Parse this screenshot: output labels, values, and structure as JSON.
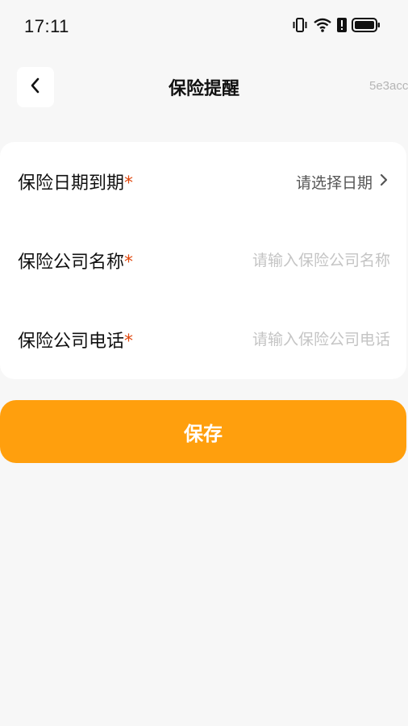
{
  "status_bar": {
    "time": "17:11",
    "icons": [
      "vibrate-icon",
      "wifi-icon",
      "alert-icon",
      "battery-icon"
    ]
  },
  "nav": {
    "back_icon": "chevron-left-icon",
    "title": "保险提醒",
    "id_text": "5e3acc"
  },
  "form": {
    "rows": [
      {
        "label": "保险日期到期",
        "required": "*",
        "value": "请选择日期",
        "chevron_icon": "chevron-right-icon"
      },
      {
        "label": "保险公司名称",
        "required": "*",
        "value": "",
        "placeholder": "请输入保险公司名称"
      },
      {
        "label": "保险公司电话",
        "required": "*",
        "value": "",
        "placeholder": "请输入保险公司电话"
      }
    ]
  },
  "save_button": {
    "label": "保存"
  },
  "colors": {
    "accent": "#ff9f0d",
    "required": "#e0470d",
    "background": "#f7f7f7",
    "card": "#ffffff"
  }
}
